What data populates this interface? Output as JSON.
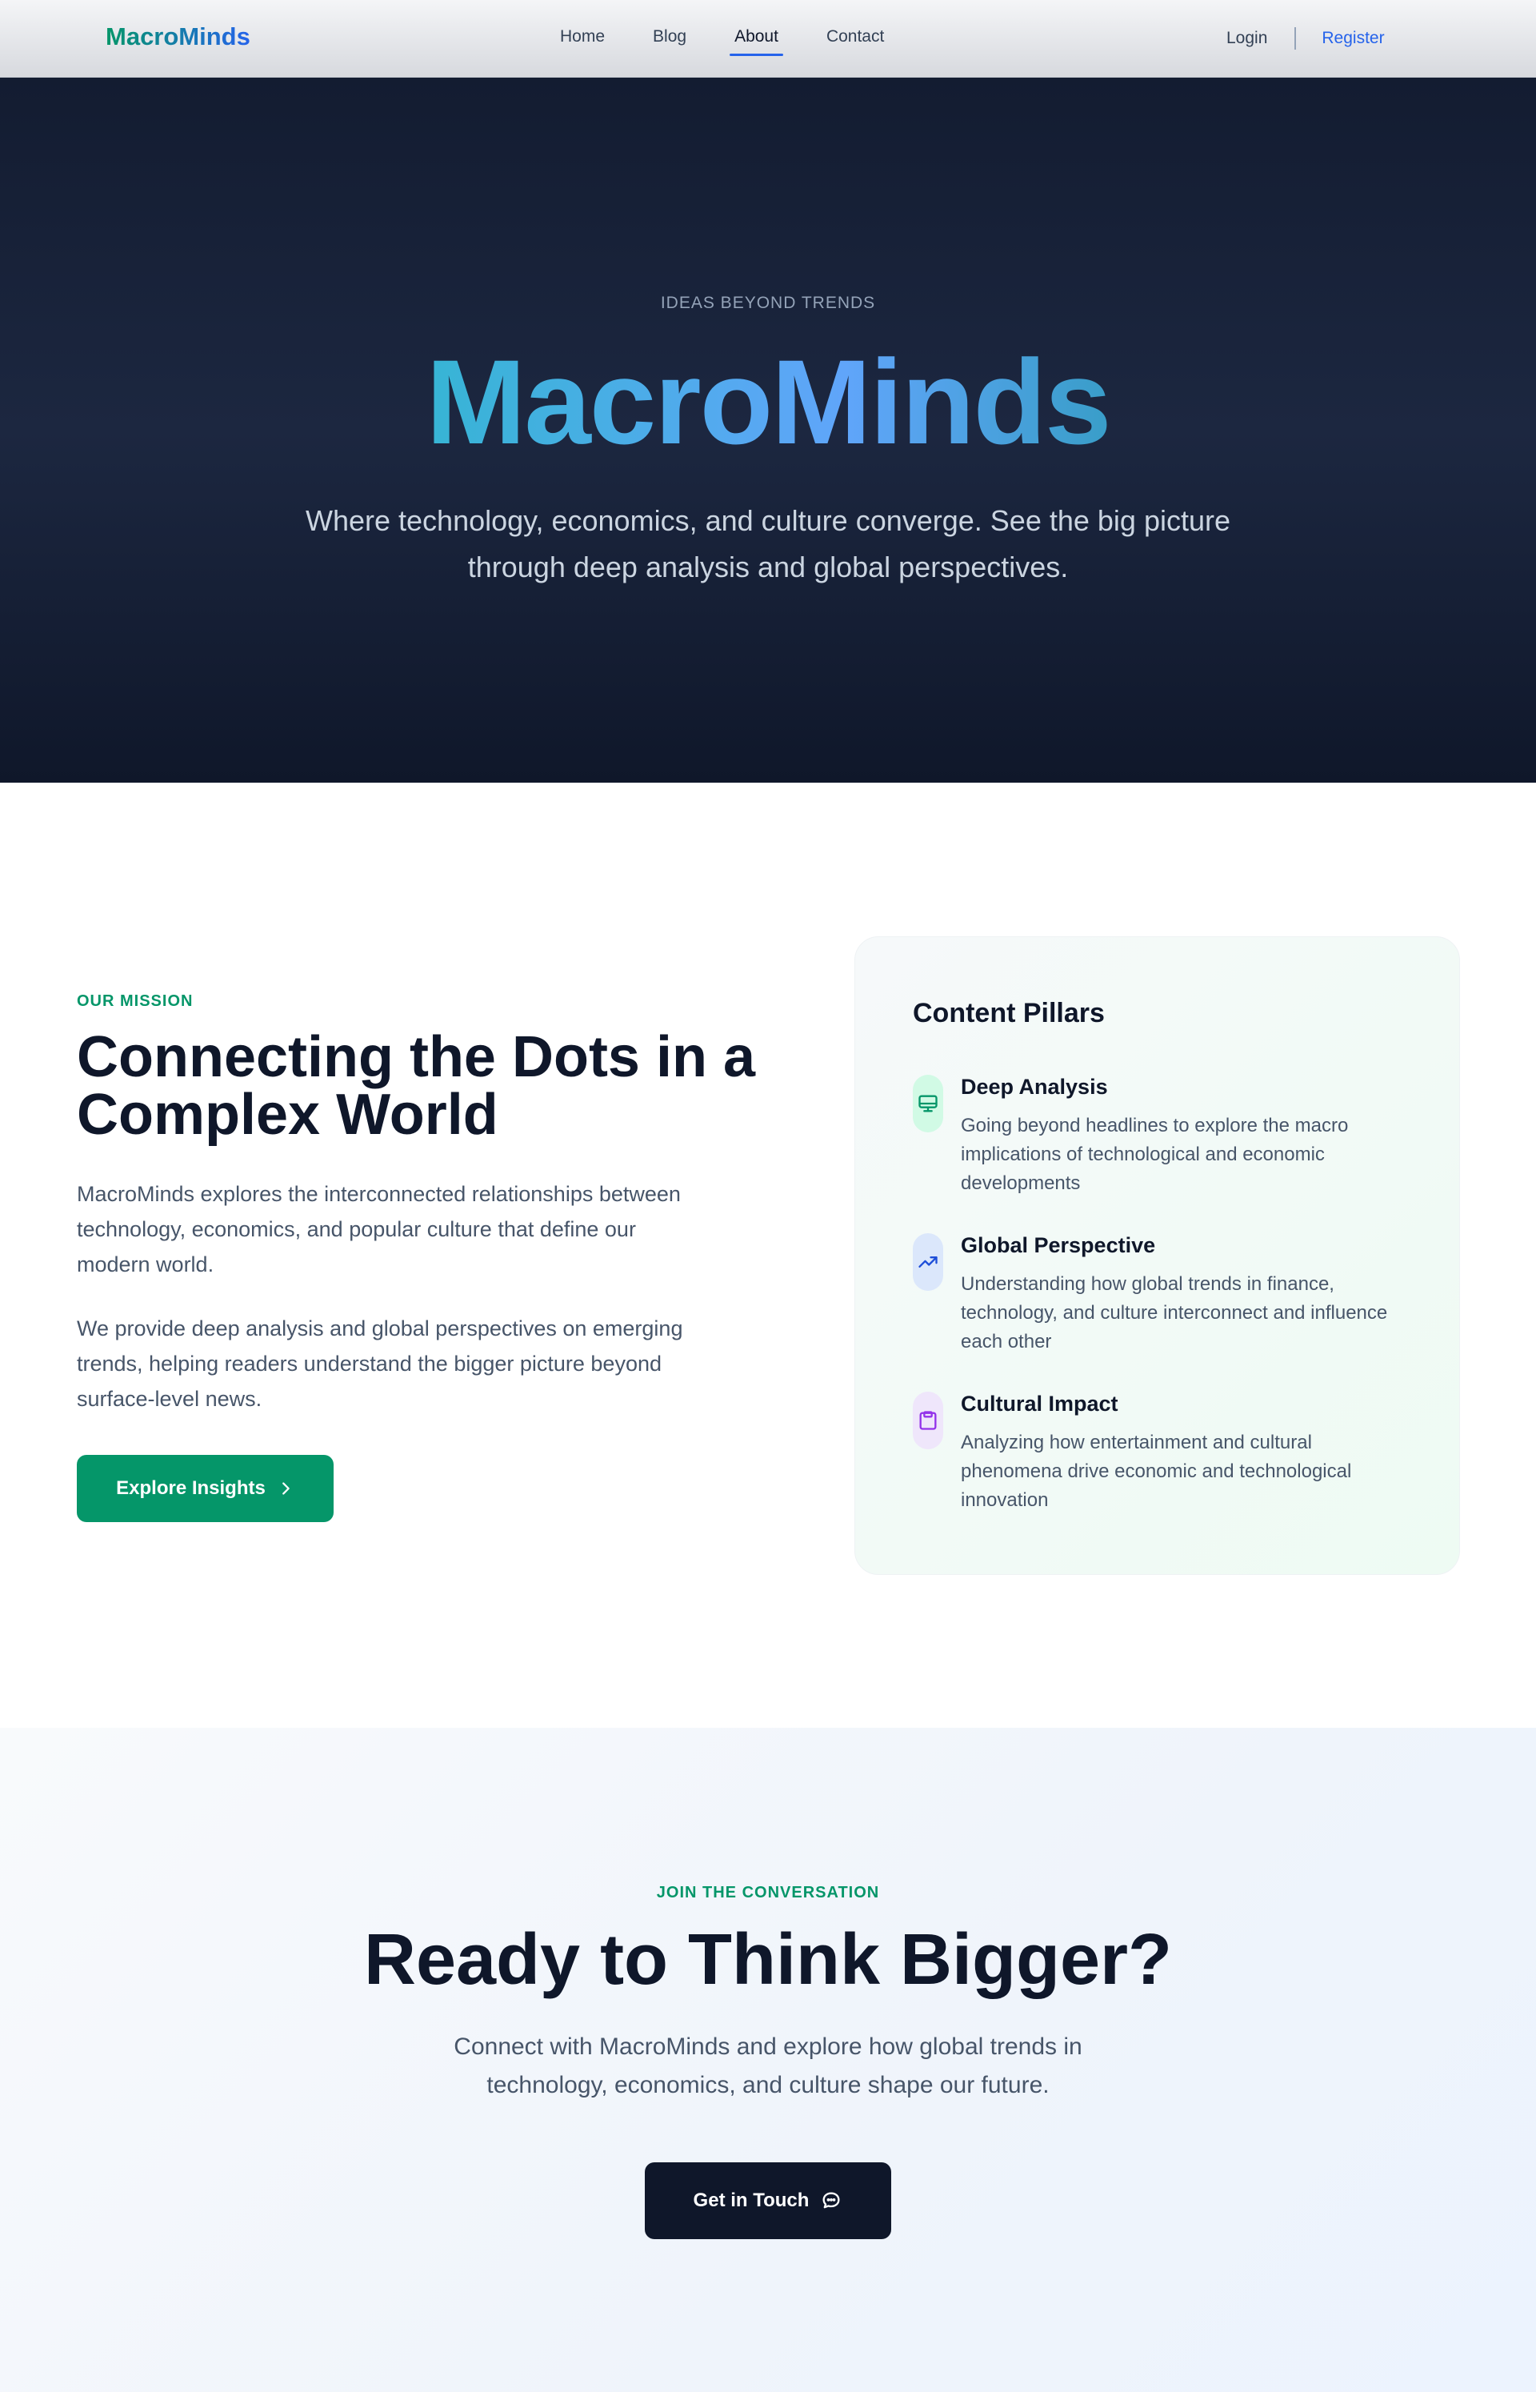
{
  "nav": {
    "brand": "MacroMinds",
    "links": [
      {
        "label": "Home",
        "active": false
      },
      {
        "label": "Blog",
        "active": false
      },
      {
        "label": "About",
        "active": true
      },
      {
        "label": "Contact",
        "active": false
      }
    ],
    "login": "Login",
    "register": "Register"
  },
  "hero": {
    "kicker": "IDEAS BEYOND TRENDS",
    "title": "MacroMinds",
    "subtitle": "Where technology, economics, and culture converge. See the big picture through deep analysis and global perspectives."
  },
  "mission": {
    "kicker": "OUR MISSION",
    "title": "Connecting the Dots in a Complex World",
    "paragraph1": "MacroMinds explores the interconnected relationships between technology, economics, and popular culture that define our modern world.",
    "paragraph2": "We provide deep analysis and global perspectives on emerging trends, helping readers understand the bigger picture beyond surface-level news.",
    "button": "Explore Insights",
    "button_icon": "chevron-right-icon"
  },
  "pillars": {
    "title": "Content Pillars",
    "items": [
      {
        "icon": "monitor-icon",
        "name": "Deep Analysis",
        "description": "Going beyond headlines to explore the macro implications of technological and economic developments",
        "icon_color": "#059669",
        "icon_bg": "#d1fae5"
      },
      {
        "icon": "trending-up-icon",
        "name": "Global Perspective",
        "description": "Understanding how global trends in finance, technology, and culture interconnect and influence each other",
        "icon_color": "#1d4ed8",
        "icon_bg": "#dbe7fb"
      },
      {
        "icon": "clipboard-icon",
        "name": "Cultural Impact",
        "description": "Analyzing how entertainment and cultural phenomena drive economic and technological innovation",
        "icon_color": "#9333ea",
        "icon_bg": "#efe6fb"
      }
    ]
  },
  "cta": {
    "kicker": "JOIN THE CONVERSATION",
    "title": "Ready to Think Bigger?",
    "subtitle": "Connect with MacroMinds and explore how global trends in technology, economics, and culture shape our future.",
    "button": "Get in Touch",
    "button_icon": "chat-bubble-icon"
  },
  "colors": {
    "accent_green": "#059669",
    "accent_blue": "#2563eb",
    "dark": "#0f172a"
  }
}
